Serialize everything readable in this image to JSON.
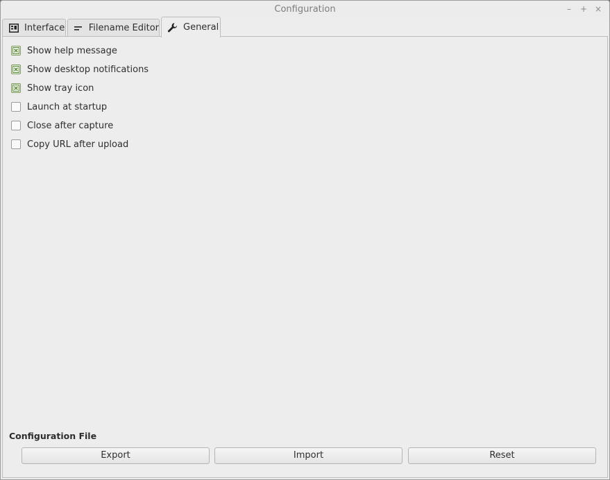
{
  "window": {
    "title": "Configuration",
    "controls": {
      "minimize": "–",
      "maximize": "+",
      "close": "×"
    }
  },
  "tabs": [
    {
      "label": "Interface",
      "icon": "interface-icon",
      "active": false
    },
    {
      "label": "Filename Editor",
      "icon": "text-lines-icon",
      "active": false
    },
    {
      "label": "General",
      "icon": "wrench-icon",
      "active": true
    }
  ],
  "general": {
    "options": [
      {
        "label": "Show help message",
        "checked": true
      },
      {
        "label": "Show desktop notifications",
        "checked": true
      },
      {
        "label": "Show tray icon",
        "checked": true
      },
      {
        "label": "Launch at startup",
        "checked": false
      },
      {
        "label": "Close after capture",
        "checked": false
      },
      {
        "label": "Copy URL after upload",
        "checked": false
      }
    ],
    "config_file": {
      "title": "Configuration File",
      "export_label": "Export",
      "import_label": "Import",
      "reset_label": "Reset"
    }
  },
  "colors": {
    "check_mark": "#5e8a3c",
    "background": "#ededed"
  }
}
